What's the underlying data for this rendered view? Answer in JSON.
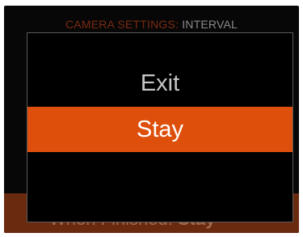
{
  "header": {
    "category": "CAMERA SETTINGS:",
    "setting": "INTERVAL"
  },
  "background": {
    "footer_label": "When Finished:",
    "footer_value": "Stay"
  },
  "dialog": {
    "options": [
      {
        "label": "Exit",
        "selected": false
      },
      {
        "label": "Stay",
        "selected": true
      }
    ]
  },
  "colors": {
    "accent": "#dd4f0b",
    "screen_background": "#070707",
    "dim_accent": "#6a2a10"
  }
}
